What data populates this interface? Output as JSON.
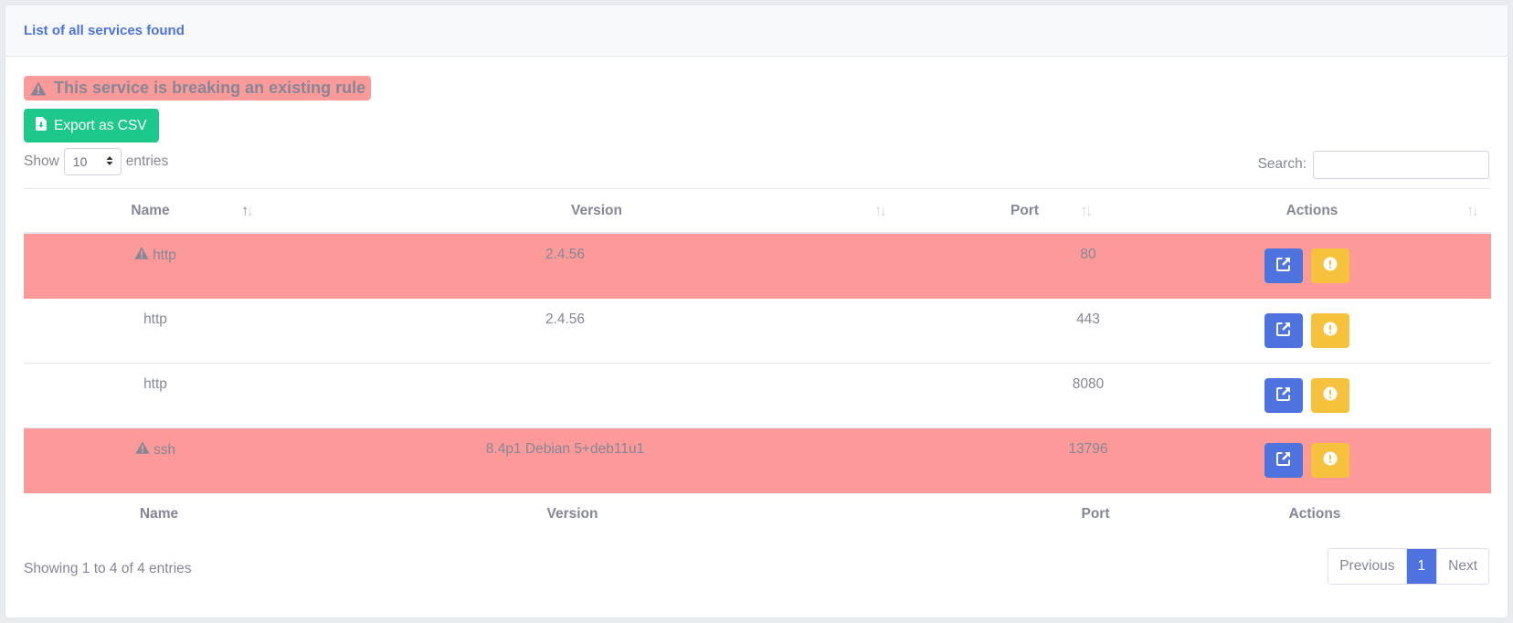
{
  "card": {
    "title": "List of all services found"
  },
  "legend": {
    "rule_text": "This service is breaking an existing rule",
    "highlight_color": "#fc9a9a"
  },
  "toolbar": {
    "export_label": "Export as CSV"
  },
  "length": {
    "show_label": "Show",
    "value": "10",
    "entries_label": "entries"
  },
  "search": {
    "label": "Search:",
    "value": "",
    "placeholder": ""
  },
  "table": {
    "headers": [
      "Name",
      "Version",
      "Port",
      "Actions"
    ],
    "rows": [
      {
        "name": "http",
        "version": "2.4.56",
        "port": "80",
        "breaking": true
      },
      {
        "name": "http",
        "version": "2.4.56",
        "port": "443",
        "breaking": false
      },
      {
        "name": "http",
        "version": "",
        "port": "8080",
        "breaking": false
      },
      {
        "name": "ssh",
        "version": "8.4p1 Debian 5+deb11u1",
        "port": "13796",
        "breaking": true
      }
    ],
    "footers": [
      "Name",
      "Version",
      "Port",
      "Actions"
    ]
  },
  "info": {
    "text": "Showing 1 to 4 of 4 entries"
  },
  "pagination": {
    "previous": "Previous",
    "current": "1",
    "next": "Next"
  },
  "icons": {
    "rule": "warning-triangle-icon",
    "export": "file-download-icon",
    "open": "external-link-icon",
    "report": "exclamation-circle-icon"
  },
  "colors": {
    "primary": "#4e73df",
    "success": "#1cc88a",
    "warning": "#f6c23e",
    "danger_row": "#fc9a9a"
  }
}
